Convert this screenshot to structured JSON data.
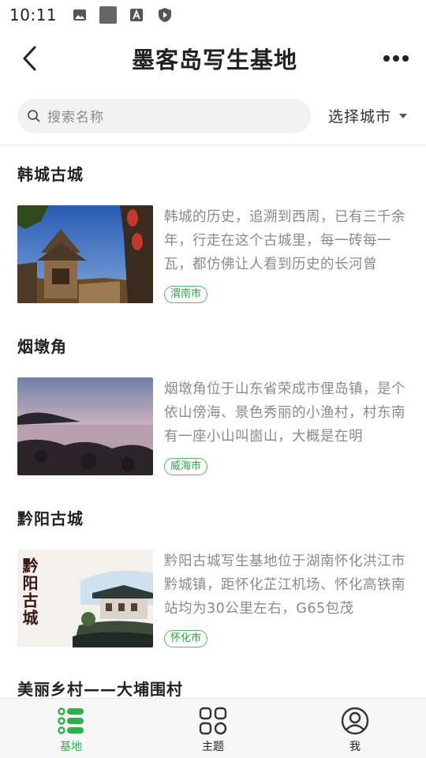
{
  "status_bar": {
    "time": "10:11",
    "icons": [
      "image-icon",
      "square-icon",
      "a-box-icon",
      "shield-icon"
    ]
  },
  "header": {
    "title": "墨客岛写生基地",
    "back_icon": "chevron-left-icon",
    "more_icon": "more-horizontal-icon"
  },
  "search": {
    "placeholder": "搜索名称",
    "city_select_label": "选择城市"
  },
  "items": [
    {
      "title": "韩城古城",
      "description": "韩城的历史，追溯到西周，已有三千余年，行走在这个古城里，每一砖每一瓦，都仿佛让人看到历史的长河曾",
      "city": "渭南市"
    },
    {
      "title": "烟墩角",
      "description": "烟墩角位于山东省荣成市俚岛镇，是个依山傍海、景色秀丽的小渔村，村东南有一座小山叫崮山，大概是在明",
      "city": "威海市"
    },
    {
      "title": "黔阳古城",
      "description": "黔阳古城写生基地位于湖南怀化洪江市黔城镇，距怀化芷江机场、怀化高铁南站均为30公里左右，G65包茂",
      "city": "怀化市",
      "poster_text": "黔阳古城"
    },
    {
      "title": "美丽乡村——大埔围村"
    }
  ],
  "tabs": [
    {
      "label": "基地",
      "icon": "list-icon",
      "active": true
    },
    {
      "label": "主题",
      "icon": "grid-icon",
      "active": false
    },
    {
      "label": "我",
      "icon": "user-icon",
      "active": false
    }
  ],
  "colors": {
    "accent": "#2db14a",
    "tag_text": "#2f9e44",
    "muted_text": "#8a8a8a"
  }
}
